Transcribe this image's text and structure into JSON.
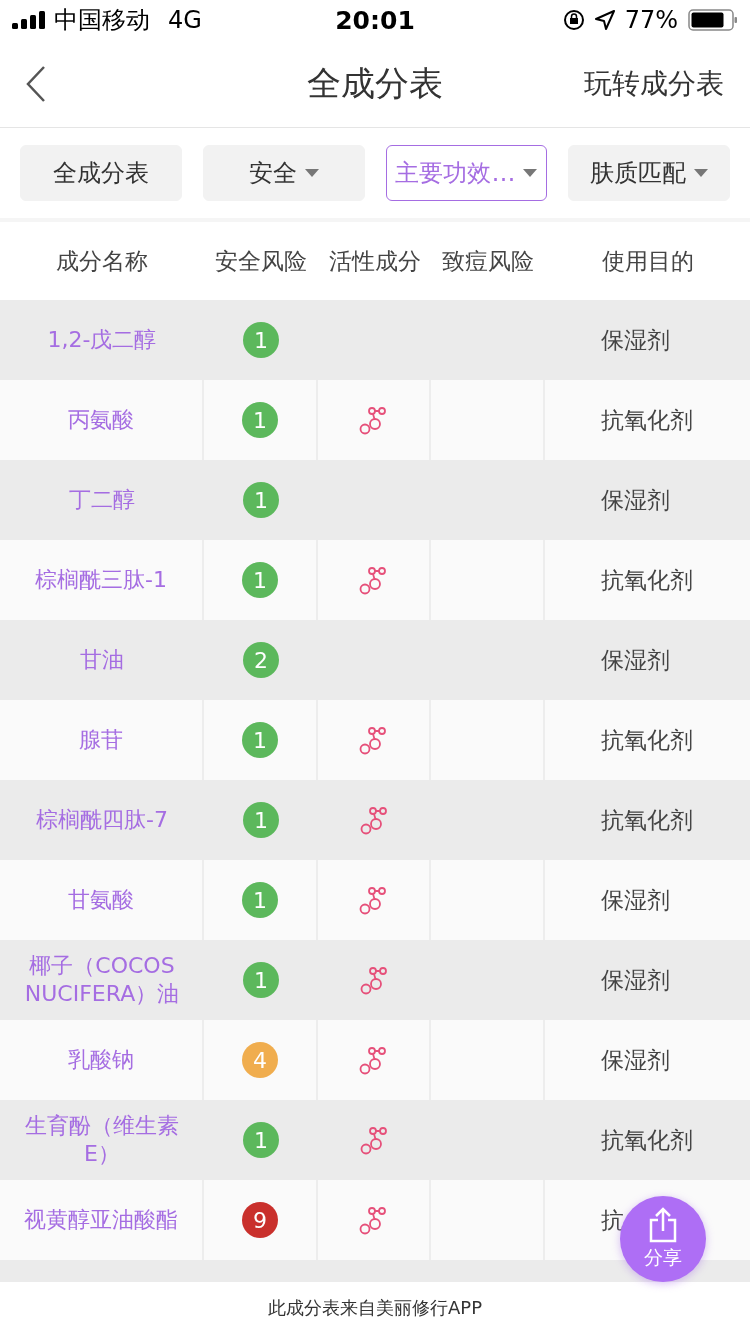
{
  "status_bar": {
    "carrier": "中国移动",
    "network": "4G",
    "time": "20:01",
    "battery": "77%"
  },
  "nav": {
    "title": "全成分表",
    "action": "玩转成分表"
  },
  "filters": [
    {
      "label": "全成分表",
      "dropdown": false,
      "selected": false
    },
    {
      "label": "安全",
      "dropdown": true,
      "selected": false
    },
    {
      "label": "主要功效…",
      "dropdown": true,
      "selected": true
    },
    {
      "label": "肤质匹配",
      "dropdown": true,
      "selected": false
    }
  ],
  "table": {
    "columns": [
      "成分名称",
      "安全风险",
      "活性成分",
      "致痘风险",
      "使用目的"
    ],
    "rows": [
      {
        "name": "1,2-戊二醇",
        "risk": "1",
        "color": "#5cb85c",
        "active": false,
        "purpose": "保湿剂"
      },
      {
        "name": "丙氨酸",
        "risk": "1",
        "color": "#5cb85c",
        "active": true,
        "purpose": "抗氧化剂"
      },
      {
        "name": "丁二醇",
        "risk": "1",
        "color": "#5cb85c",
        "active": false,
        "purpose": "保湿剂"
      },
      {
        "name": "棕榈酰三肽-1",
        "risk": "1",
        "color": "#5cb85c",
        "active": true,
        "purpose": "抗氧化剂"
      },
      {
        "name": "甘油",
        "risk": "2",
        "color": "#5cb85c",
        "active": false,
        "purpose": "保湿剂"
      },
      {
        "name": "腺苷",
        "risk": "1",
        "color": "#5cb85c",
        "active": true,
        "purpose": "抗氧化剂"
      },
      {
        "name": "棕榈酰四肽-7",
        "risk": "1",
        "color": "#5cb85c",
        "active": true,
        "purpose": "抗氧化剂"
      },
      {
        "name": "甘氨酸",
        "risk": "1",
        "color": "#5cb85c",
        "active": true,
        "purpose": "保湿剂"
      },
      {
        "name": "椰子（COCOS NUCIFERA）油",
        "risk": "1",
        "color": "#5cb85c",
        "active": true,
        "purpose": "保湿剂"
      },
      {
        "name": "乳酸钠",
        "risk": "4",
        "color": "#f0ad4e",
        "active": true,
        "purpose": "保湿剂"
      },
      {
        "name": "生育酚（维生素E）",
        "risk": "1",
        "color": "#5cb85c",
        "active": true,
        "purpose": "抗氧化剂"
      },
      {
        "name": "视黄醇亚油酸酯",
        "risk": "9",
        "color": "#c9302c",
        "active": true,
        "purpose": "抗"
      }
    ]
  },
  "share": {
    "label": "分享"
  },
  "footer": "此成分表来自美丽修行APP"
}
